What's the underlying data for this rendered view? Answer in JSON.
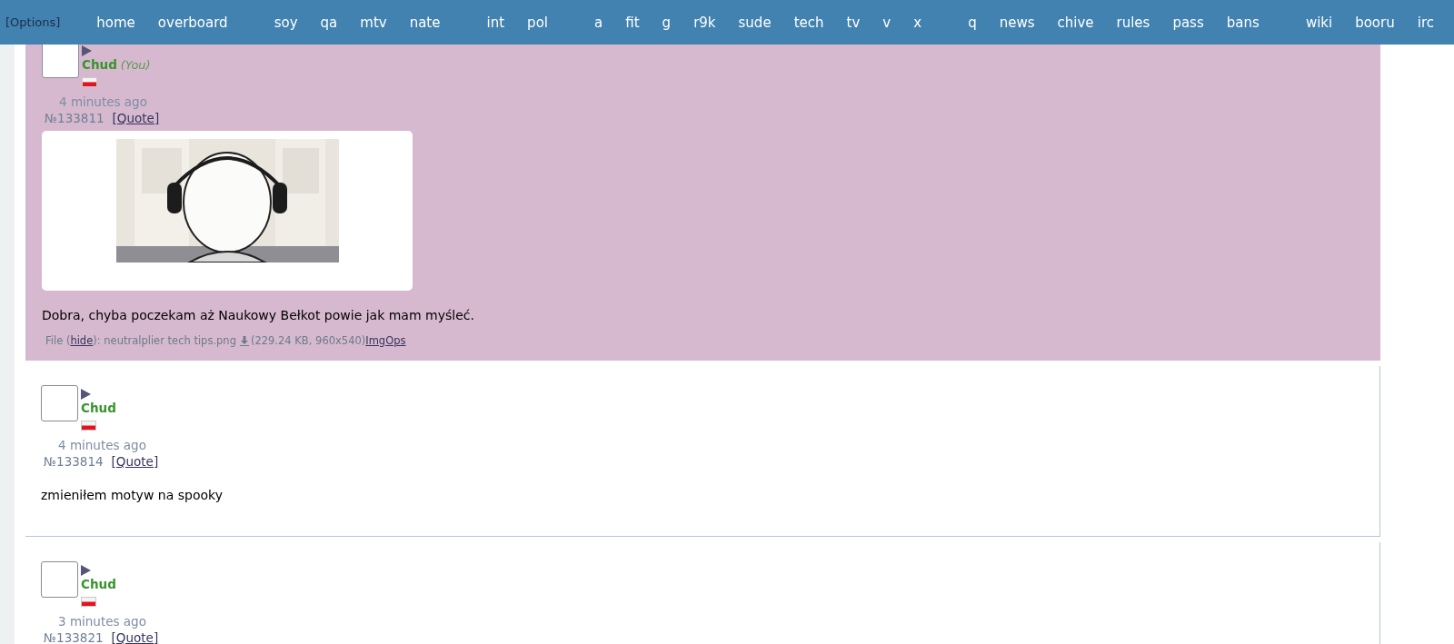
{
  "nav": {
    "options": "[Options]",
    "groups": [
      [
        "home",
        "overboard"
      ],
      [
        "soy",
        "qa",
        "mtv",
        "nate"
      ],
      [
        "int",
        "pol"
      ],
      [
        "a",
        "fit",
        "g",
        "r9k",
        "sude",
        "tech",
        "tv",
        "v",
        "x"
      ],
      [
        "q",
        "news",
        "chive",
        "rules",
        "pass",
        "bans"
      ],
      [
        "wiki",
        "booru",
        "irc"
      ]
    ]
  },
  "posts": [
    {
      "own": true,
      "name": "Chud",
      "you": "(You)",
      "time": "4 minutes ago",
      "number": "№133811",
      "quote": "[Quote]",
      "comment": "Dobra, chyba poczekam aż Naukowy Bełkot powie jak mam myśleć.",
      "file": {
        "label": "File (",
        "hide": "hide",
        "name": "): neutralplier tech tips.png",
        "meta": "(229.24 KB, 960x540)",
        "imgops": "ImgOps"
      }
    },
    {
      "own": false,
      "name": "Chud",
      "time": "4 minutes ago",
      "number": "№133814",
      "quote": "[Quote]",
      "comment": "zmieniłem motyw na spooky"
    },
    {
      "own": false,
      "name": "Chud",
      "time": "3 minutes ago",
      "number": "№133821",
      "quote": "[Quote]"
    }
  ]
}
